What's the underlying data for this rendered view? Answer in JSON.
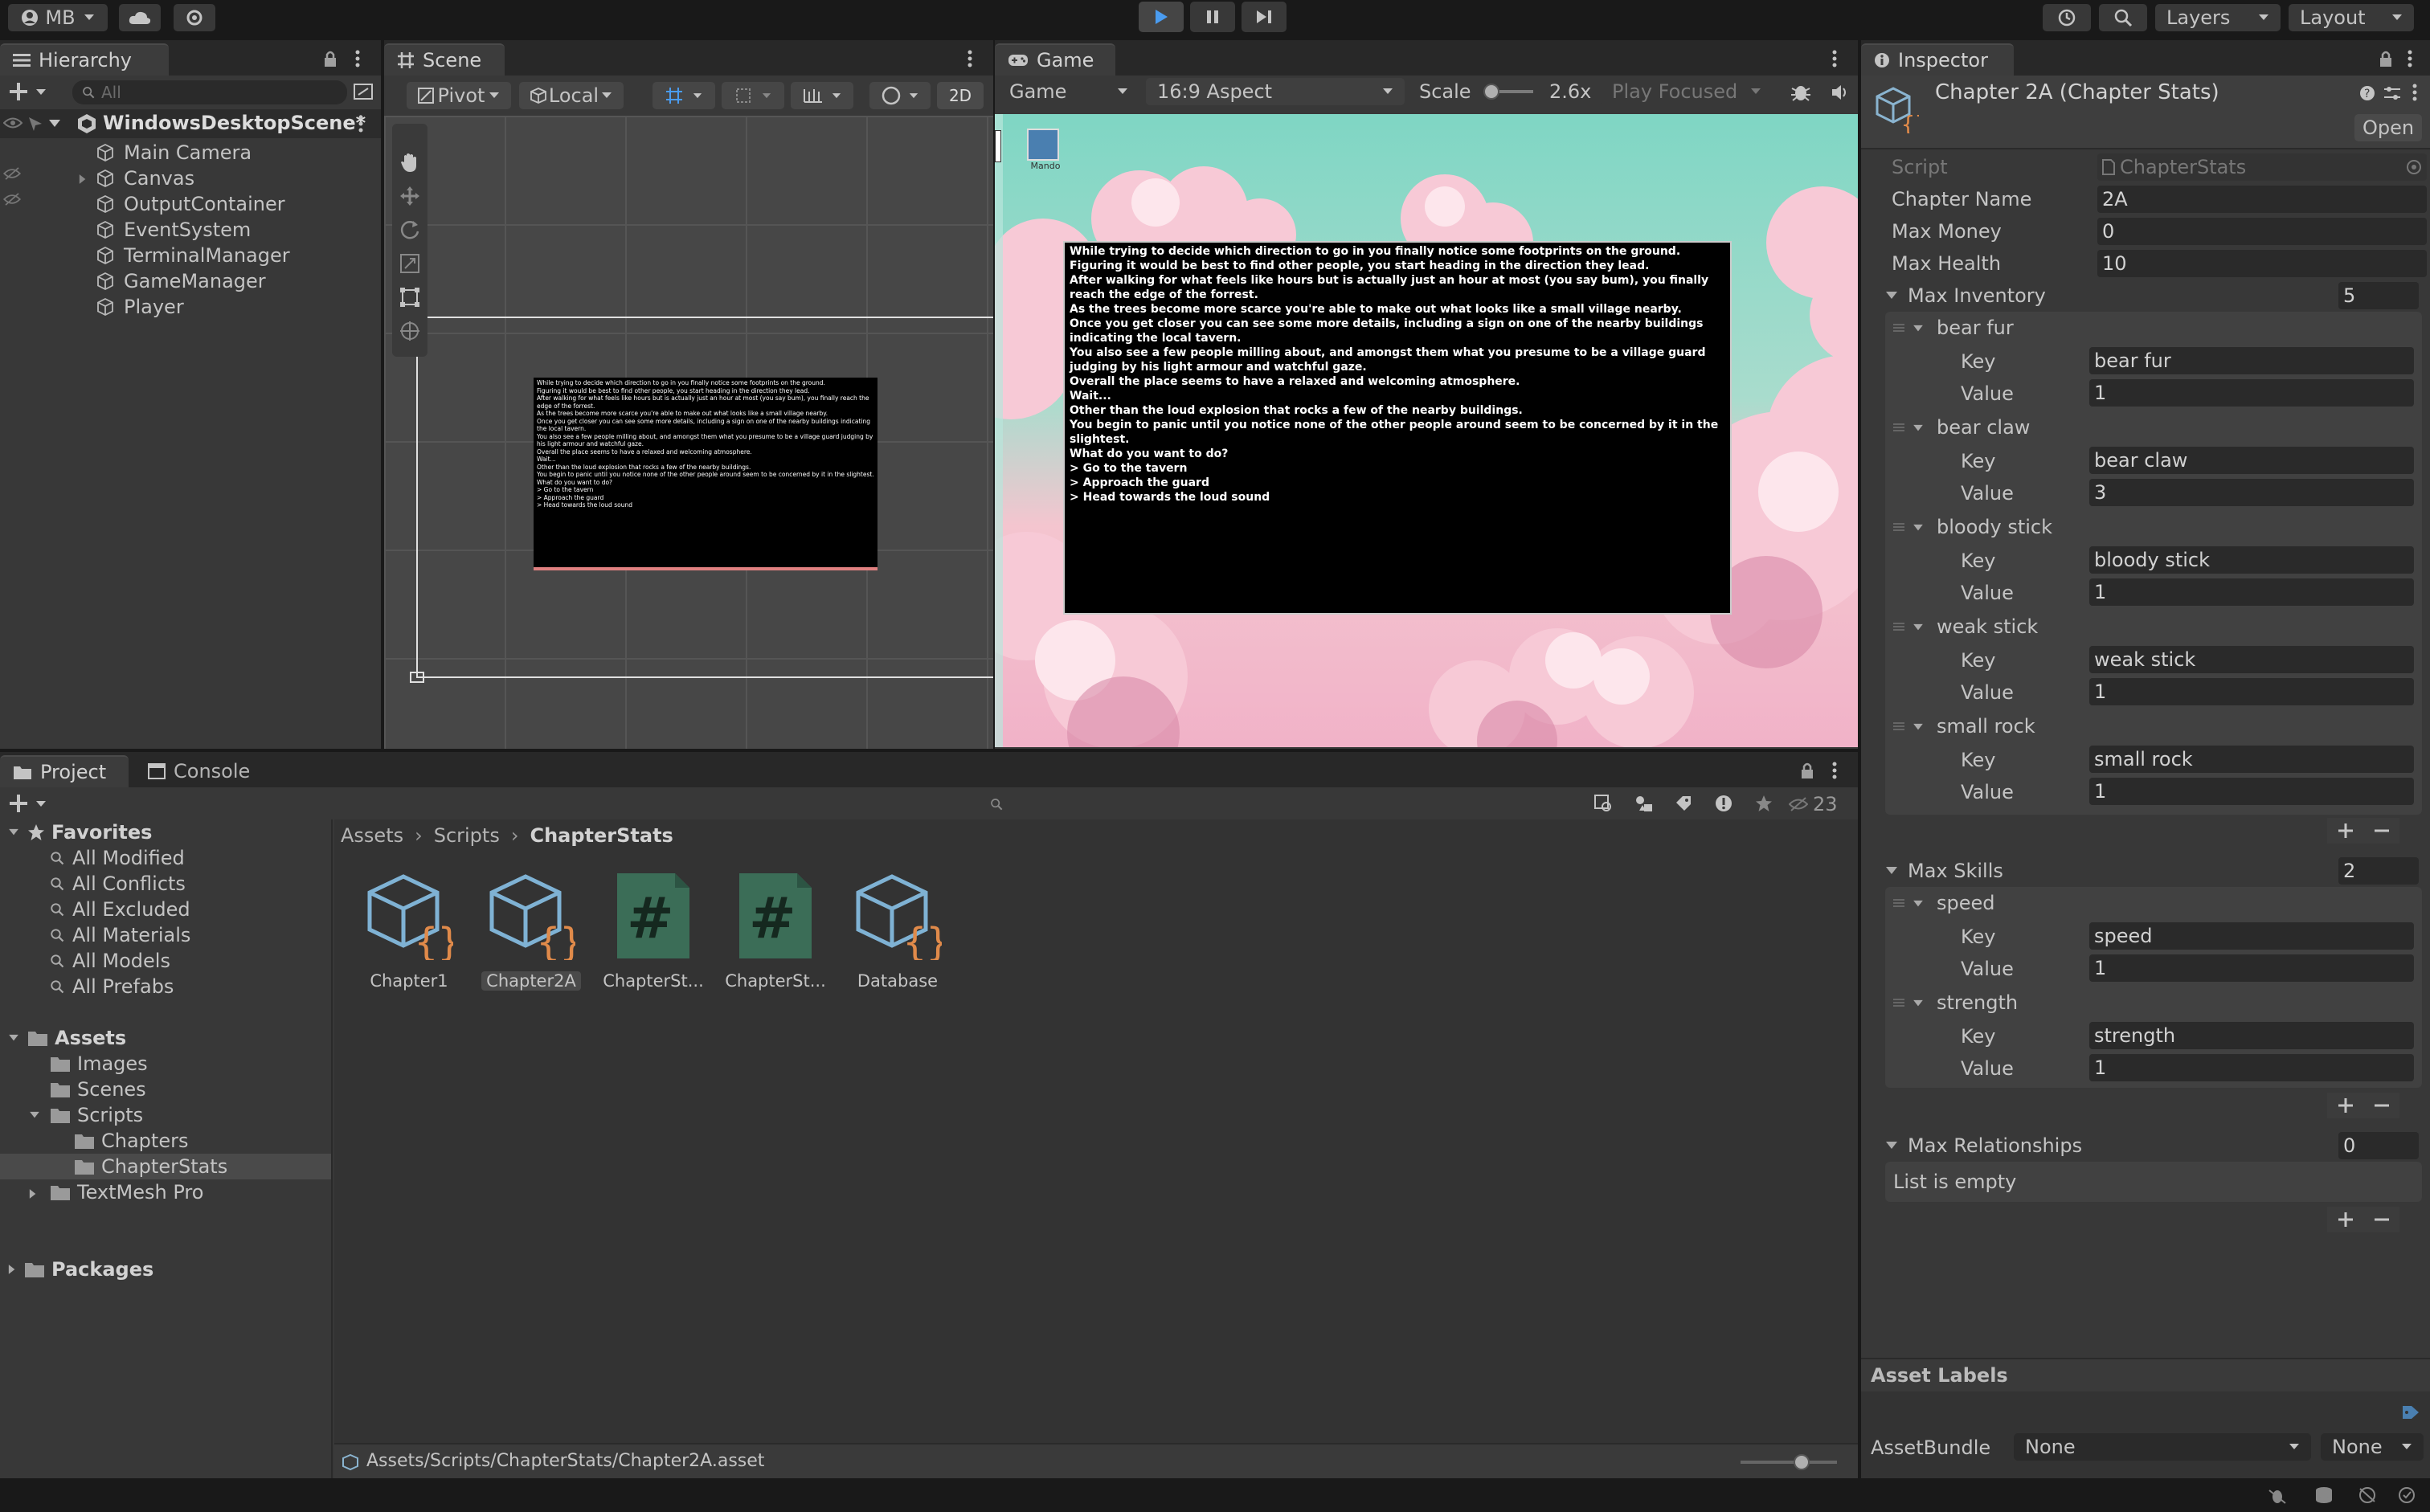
{
  "toolbar": {
    "account": "MB",
    "layers": "Layers",
    "layout": "Layout"
  },
  "hierarchy": {
    "tab": "Hierarchy",
    "search_placeholder": "All",
    "scene": "WindowsDesktopScene*",
    "items": [
      "Main Camera",
      "Canvas",
      "OutputContainer",
      "EventSystem",
      "TerminalManager",
      "GameManager",
      "Player"
    ]
  },
  "scene": {
    "tab": "Scene",
    "pivot": "Pivot",
    "local": "Local",
    "mode_2d": "2D"
  },
  "game": {
    "tab": "Game",
    "display": "Game",
    "aspect": "16:9 Aspect",
    "scale_label": "Scale",
    "scale_value": "2.6x",
    "play_mode": "Play Focused",
    "desktop_icon_label": "Mando",
    "terminal_lines": [
      "While trying to decide which direction to go in you finally notice some footprints on the ground.",
      "Figuring it would be best to find other people, you start heading in the direction they lead.",
      "After walking for what feels like hours but is actually just an hour at most (you say bum), you finally reach the edge of the forrest.",
      "As the trees become more scarce you're able to make out what looks like a small village nearby.",
      "Once you get closer you can see some more details, including a sign on one of the nearby buildings indicating the local tavern.",
      "You also see a few people milling about, and amongst them what you presume to be a village guard judging by his light armour and watchful gaze.",
      "Overall the place seems to have a relaxed and welcoming atmosphere.",
      "Wait...",
      "Other than the loud explosion that rocks a few of the nearby buildings.",
      "You begin to panic until you notice none of the other people around seem to be concerned by it in the slightest.",
      "What do you want to do?",
      "> Go to the tavern",
      "> Approach the guard",
      "> Head towards the loud sound"
    ]
  },
  "inspector": {
    "tab": "Inspector",
    "title": "Chapter 2A (Chapter Stats)",
    "open_button": "Open",
    "script_label": "Script",
    "script_value": "ChapterStats",
    "chapter_name_label": "Chapter Name",
    "chapter_name_value": "2A",
    "max_money_label": "Max Money",
    "max_money_value": "0",
    "max_health_label": "Max Health",
    "max_health_value": "10",
    "key_label": "Key",
    "value_label": "Value",
    "max_inventory": {
      "label": "Max Inventory",
      "count": "5",
      "items": [
        {
          "name": "bear fur",
          "key": "bear fur",
          "value": "1"
        },
        {
          "name": "bear claw",
          "key": "bear claw",
          "value": "3"
        },
        {
          "name": "bloody stick",
          "key": "bloody stick",
          "value": "1"
        },
        {
          "name": "weak stick",
          "key": "weak stick",
          "value": "1"
        },
        {
          "name": "small rock",
          "key": "small rock",
          "value": "1"
        }
      ]
    },
    "max_skills": {
      "label": "Max Skills",
      "count": "2",
      "items": [
        {
          "name": "speed",
          "key": "speed",
          "value": "1"
        },
        {
          "name": "strength",
          "key": "strength",
          "value": "1"
        }
      ]
    },
    "max_relationships": {
      "label": "Max Relationships",
      "count": "0",
      "empty_text": "List is empty"
    },
    "asset_labels": "Asset Labels",
    "asset_bundle_label": "AssetBundle",
    "asset_bundle_value": "None",
    "asset_variant_value": "None"
  },
  "project": {
    "tab_project": "Project",
    "tab_console": "Console",
    "hidden_count": "23",
    "favorites_label": "Favorites",
    "favorites": [
      "All Modified",
      "All Conflicts",
      "All Excluded",
      "All Materials",
      "All Models",
      "All Prefabs"
    ],
    "assets_label": "Assets",
    "folders": [
      "Images",
      "Scenes",
      "Scripts",
      "Chapters",
      "ChapterStats",
      "TextMesh Pro"
    ],
    "packages_label": "Packages",
    "breadcrumb": [
      "Assets",
      "Scripts",
      "ChapterStats"
    ],
    "assets": [
      "Chapter1",
      "Chapter2A",
      "ChapterSt...",
      "ChapterSt...",
      "Database"
    ],
    "status_path": "Assets/Scripts/ChapterStats/Chapter2A.asset"
  }
}
